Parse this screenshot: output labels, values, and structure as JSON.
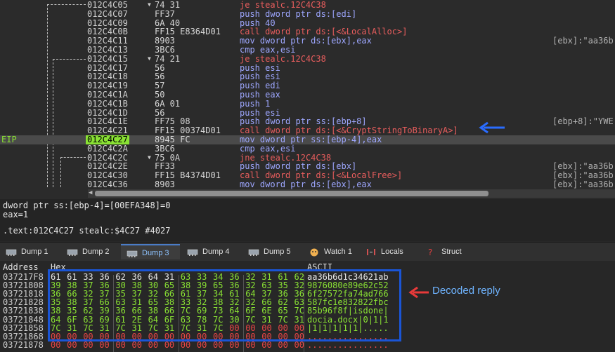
{
  "disasm": {
    "eip_label": "EIP",
    "rows": [
      {
        "addr": "012C4C05",
        "bytes": "74 31",
        "mn": "je",
        "ops": "stealc.12C4C38",
        "type": "jmp",
        "comment": "",
        "arrow": "v"
      },
      {
        "addr": "012C4C07",
        "bytes": "FF37",
        "mn": "push",
        "ops": "dword ptr ds:[edi]",
        "type": "push",
        "comment": ""
      },
      {
        "addr": "012C4C09",
        "bytes": "6A 40",
        "mn": "push",
        "ops": "40",
        "type": "push",
        "comment": ""
      },
      {
        "addr": "012C4C0B",
        "bytes": "FF15 E8364D01",
        "mn": "call",
        "ops": "dword ptr ds:[<&LocalAlloc>]",
        "type": "call",
        "comment": ""
      },
      {
        "addr": "012C4C11",
        "bytes": "8903",
        "mn": "mov",
        "ops": "dword ptr ds:[ebx],eax",
        "type": "mov",
        "comment": "[ebx]:\"aa36b"
      },
      {
        "addr": "012C4C13",
        "bytes": "3BC6",
        "mn": "cmp",
        "ops": "eax,esi",
        "type": "cmp",
        "comment": ""
      },
      {
        "addr": "012C4C15",
        "bytes": "74 21",
        "mn": "je",
        "ops": "stealc.12C4C38",
        "type": "jmp",
        "comment": "",
        "arrow": "v"
      },
      {
        "addr": "012C4C17",
        "bytes": "56",
        "mn": "push",
        "ops": "esi",
        "type": "push",
        "comment": ""
      },
      {
        "addr": "012C4C18",
        "bytes": "56",
        "mn": "push",
        "ops": "esi",
        "type": "push",
        "comment": ""
      },
      {
        "addr": "012C4C19",
        "bytes": "57",
        "mn": "push",
        "ops": "edi",
        "type": "push",
        "comment": ""
      },
      {
        "addr": "012C4C1A",
        "bytes": "50",
        "mn": "push",
        "ops": "eax",
        "type": "push",
        "comment": ""
      },
      {
        "addr": "012C4C1B",
        "bytes": "6A 01",
        "mn": "push",
        "ops": "1",
        "type": "push",
        "comment": ""
      },
      {
        "addr": "012C4C1D",
        "bytes": "56",
        "mn": "push",
        "ops": "esi",
        "type": "push",
        "comment": ""
      },
      {
        "addr": "012C4C1E",
        "bytes": "FF75 08",
        "mn": "push",
        "ops": "dword ptr ss:[ebp+8]",
        "type": "push",
        "comment": "[ebp+8]:\"YWE"
      },
      {
        "addr": "012C4C21",
        "bytes": "FF15 00374D01",
        "mn": "call",
        "ops": "dword ptr ds:[<&CryptStringToBinaryA>]",
        "type": "call",
        "comment": ""
      },
      {
        "addr": "012C4C27",
        "bytes": "8945 FC",
        "mn": "mov",
        "ops": "dword ptr ss:[ebp-4],eax",
        "type": "mov",
        "comment": "",
        "eip": true
      },
      {
        "addr": "012C4C2A",
        "bytes": "3BC6",
        "mn": "cmp",
        "ops": "eax,esi",
        "type": "cmp",
        "comment": ""
      },
      {
        "addr": "012C4C2C",
        "bytes": "75 0A",
        "mn": "jne",
        "ops": "stealc.12C4C38",
        "type": "jmp",
        "comment": "",
        "arrow": "v"
      },
      {
        "addr": "012C4C2E",
        "bytes": "FF33",
        "mn": "push",
        "ops": "dword ptr ds:[ebx]",
        "type": "push",
        "comment": "[ebx]:\"aa36b"
      },
      {
        "addr": "012C4C30",
        "bytes": "FF15 B4374D01",
        "mn": "call",
        "ops": "dword ptr ds:[<&LocalFree>]",
        "type": "call",
        "comment": "[ebx]:\"aa36b"
      },
      {
        "addr": "012C4C36",
        "bytes": "8903",
        "mn": "mov",
        "ops": "dword ptr ds:[ebx],eax",
        "type": "mov",
        "comment": "[ebx]:\"aa36b"
      }
    ]
  },
  "info": {
    "line1": "dword ptr ss:[ebp-4]=[00EFA348]=0",
    "line2": "eax=1",
    "line3": ".text:012C4C27 stealc:$4C27 #4027"
  },
  "tabs": [
    {
      "label": "Dump 1",
      "icon": "memory-icon",
      "active": false
    },
    {
      "label": "Dump 2",
      "icon": "memory-icon",
      "active": false
    },
    {
      "label": "Dump 3",
      "icon": "memory-icon",
      "active": true
    },
    {
      "label": "Dump 4",
      "icon": "memory-icon",
      "active": false
    },
    {
      "label": "Dump 5",
      "icon": "memory-icon",
      "active": false
    },
    {
      "label": "Watch 1",
      "icon": "glasses-icon",
      "active": false
    },
    {
      "label": "Locals",
      "icon": "locals-icon",
      "active": false
    },
    {
      "label": "Struct",
      "icon": "struct-icon",
      "active": false
    }
  ],
  "dump": {
    "header_address": "Address",
    "header_hex": "Hex",
    "header_ascii": "ASCII",
    "rows": [
      {
        "addr": "037217F8",
        "hex": [
          "61",
          "61",
          "33",
          "36",
          "62",
          "36",
          "64",
          "31",
          "63",
          "33",
          "34",
          "36",
          "32",
          "31",
          "61",
          "62"
        ],
        "ascii": "aa36b6d1c34621ab",
        "color": "w"
      },
      {
        "addr": "03721808",
        "hex": [
          "39",
          "38",
          "37",
          "36",
          "30",
          "38",
          "30",
          "65",
          "38",
          "39",
          "65",
          "36",
          "32",
          "63",
          "35",
          "32"
        ],
        "ascii": "9876080e89e62c52",
        "color": "g"
      },
      {
        "addr": "03721818",
        "hex": [
          "36",
          "66",
          "32",
          "37",
          "35",
          "37",
          "32",
          "66",
          "61",
          "37",
          "34",
          "61",
          "64",
          "37",
          "36",
          "36"
        ],
        "ascii": "6f27572fa74ad766",
        "color": "g"
      },
      {
        "addr": "03721828",
        "hex": [
          "35",
          "38",
          "37",
          "66",
          "63",
          "31",
          "65",
          "38",
          "33",
          "32",
          "38",
          "32",
          "32",
          "66",
          "62",
          "63"
        ],
        "ascii": "587fc1e832822fbc",
        "color": "g"
      },
      {
        "addr": "03721838",
        "hex": [
          "38",
          "35",
          "62",
          "39",
          "36",
          "66",
          "38",
          "66",
          "7C",
          "69",
          "73",
          "64",
          "6F",
          "6E",
          "65",
          "7C"
        ],
        "ascii": "85b96f8f|isdone|",
        "color": "g"
      },
      {
        "addr": "03721848",
        "hex": [
          "64",
          "6F",
          "63",
          "69",
          "61",
          "2E",
          "64",
          "6F",
          "63",
          "78",
          "7C",
          "30",
          "7C",
          "31",
          "7C",
          "31"
        ],
        "ascii": "docia.docx|0|1|1",
        "color": "g"
      },
      {
        "addr": "03721858",
        "hex": [
          "7C",
          "31",
          "7C",
          "31",
          "7C",
          "31",
          "7C",
          "31",
          "7C",
          "31",
          "7C",
          "00",
          "00",
          "00",
          "00",
          "00"
        ],
        "ascii": "|1|1|1|1|1|.....",
        "color": "g"
      },
      {
        "addr": "03721868",
        "hex": [
          "00",
          "00",
          "00",
          "00",
          "00",
          "00",
          "00",
          "00",
          "00",
          "00",
          "00",
          "00",
          "00",
          "00",
          "00",
          "00"
        ],
        "ascii": "................",
        "color": "r"
      },
      {
        "addr": "03721878",
        "hex": [
          "00",
          "00",
          "00",
          "00",
          "00",
          "00",
          "00",
          "00",
          "00",
          "00",
          "00",
          "00",
          "00",
          "00",
          "00",
          "00"
        ],
        "ascii": "................",
        "color": "r"
      }
    ]
  },
  "annotation": {
    "label": "Decoded reply",
    "color": "#6fb4ff"
  },
  "colors": {
    "eip": "#8ae234",
    "highlight_box": "#1a55d6",
    "arrow_red": "#e83a3a"
  }
}
